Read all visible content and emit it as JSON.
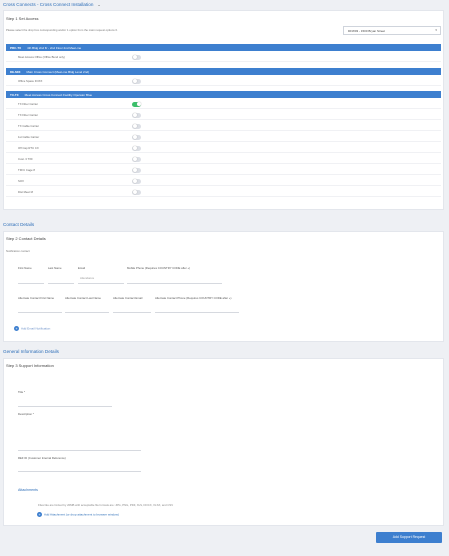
{
  "sections": {
    "cross_connects": "Cross Connects - Cross Connect Installation",
    "contact_details": "Contact Details",
    "general_info": "General Information Details"
  },
  "step1": {
    "title": "Step 1 Set Access",
    "hint": "Please select the drop box corresponding and/or 1 option from the main request options 0.",
    "dropdown_value": "DFW03 - 1500 Bryan Street"
  },
  "groups": [
    {
      "code": "PRC-TX",
      "desc": "4th Bldg 2nd flr - 2nd Floor 2nd Meet-me",
      "items": [
        {
          "label": "Meet Access Office (Office Bund only)",
          "on": false
        }
      ]
    },
    {
      "code": "DE-MIX",
      "desc": "Main Cross Connect (Meet-me Bldg Level 2nd)",
      "items": [
        {
          "label": "Office Space FOXX",
          "on": false
        }
      ]
    },
    {
      "code": "TX-TX",
      "desc": "Meet Access Cross Connect Facility Operator Blue",
      "items": [
        {
          "label": "TX Fiber Carrier",
          "on": true
        },
        {
          "label": "TX Fiber Carrier",
          "on": false
        },
        {
          "label": "TX Cable Carrier",
          "on": false
        },
        {
          "label": "1st Cable Carrier",
          "on": false
        },
        {
          "label": "Off Cap RTU CX",
          "on": false
        },
        {
          "label": "Cust. 3 TXF",
          "on": false
        },
        {
          "label": "TFFC Cage 8",
          "on": false
        },
        {
          "label": "SOX",
          "on": false
        },
        {
          "label": "Dist Meet M",
          "on": false
        }
      ]
    }
  ],
  "step2": {
    "title": "Step 2 Contact Details",
    "hint": "Notification contact",
    "fields": [
      "First Name",
      "Last Name",
      "Email",
      "Mobile Phone (Requires COUNTRY CODE after +)"
    ],
    "email_placeholder": "Attendance",
    "alt_fields": [
      "Alternate Contact First Name",
      "Alternate Contact Last Name",
      "Alternate Contact Email",
      "Alternate Contact Phone (Requires COUNTRY CODE after +)"
    ],
    "add_link": "Add Email Notification"
  },
  "step3": {
    "title": "Step 3 Support Information",
    "title_field": "Title *",
    "description_field": "Description *",
    "ref_field": "REF ID (Customer Internal Reference)",
    "attachments_title": "Attachments",
    "attachments_hint": "Files like are limited by 20MB with acceptable file formats are: JPG, PNG, PDF, XLS, DOCX, XLSX, and CSV",
    "add_attachment": "Add Attachment (or drop attachment to browser window)"
  },
  "submit_label": "Add Support Request"
}
